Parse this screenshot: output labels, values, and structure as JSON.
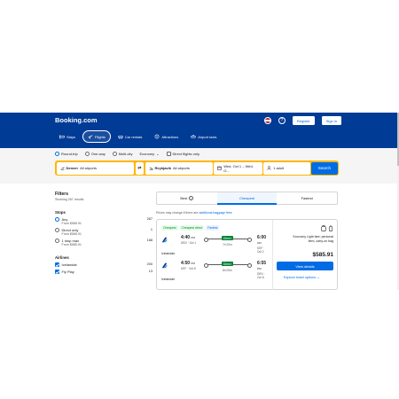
{
  "header": {
    "logo": "Booking.com",
    "register_label": "Register",
    "signin_label": "Sign in",
    "help_label": "?",
    "nav": [
      {
        "label": "Stays",
        "icon": "bed-icon"
      },
      {
        "label": "Flights",
        "icon": "plane-icon"
      },
      {
        "label": "Car rentals",
        "icon": "car-icon"
      },
      {
        "label": "Attractions",
        "icon": "attractions-icon"
      },
      {
        "label": "Airport taxis",
        "icon": "taxi-icon"
      }
    ]
  },
  "search": {
    "trip_types": [
      "Round-trip",
      "One-way",
      "Multi-city"
    ],
    "cabin": "Economy",
    "direct_only": "Direct flights only",
    "from_city": "Denver",
    "from_sub": "All airports",
    "to_city": "Reykjavík",
    "to_sub": "All airports",
    "dates": "Wed, Oct 1 – Wed, O...",
    "travelers": "1 adult",
    "button": "Search"
  },
  "filters": {
    "title": "Filters",
    "showing": "Showing 267 results",
    "stops_title": "Stops",
    "stops": [
      {
        "label": "Any",
        "price": "From $585.91",
        "count": "267"
      },
      {
        "label": "Direct only",
        "price": "From $585.91",
        "count": "1"
      },
      {
        "label": "1 stop max",
        "price": "From $585.91",
        "count": "168"
      }
    ],
    "airlines_title": "Airlines",
    "airlines": [
      {
        "label": "Icelandair",
        "count": "200"
      },
      {
        "label": "Fly Play",
        "count": "13"
      }
    ]
  },
  "sort": {
    "tabs": [
      "Best",
      "Cheapest",
      "Fastest"
    ],
    "active": "Cheapest"
  },
  "price_note": {
    "text": "Prices may change if there are ",
    "link": "additional baggage fees"
  },
  "result": {
    "badges": [
      "Cheapest",
      "Cheapest direct",
      "Fastest"
    ],
    "legs": [
      {
        "dep_time": "4:40",
        "dep_ampm": "PM",
        "dep_info": "DEN · Oct 1",
        "arr_time": "6:00",
        "arr_ampm": "AM",
        "arr_info": "KEF · Oct 2",
        "stops": "Direct",
        "duration": "7h 20m",
        "carrier": "Icelandair"
      },
      {
        "dep_time": "4:50",
        "dep_ampm": "PM",
        "dep_info": "KEF · Oct 8",
        "arr_time": "6:55",
        "arr_ampm": "PM",
        "arr_info": "DEN · Oct 8",
        "stops": "Direct",
        "duration": "8h 05m",
        "carrier": "Icelandair"
      }
    ],
    "fare_desc": "Economy Light fare: personal item, carry-on bag",
    "price": "$585.91",
    "view_details": "View details",
    "explore": "Explore ticket options"
  },
  "colors": {
    "brand": "#003b95",
    "accent": "#006ce4",
    "highlight": "#ffb700",
    "green": "#008234"
  }
}
